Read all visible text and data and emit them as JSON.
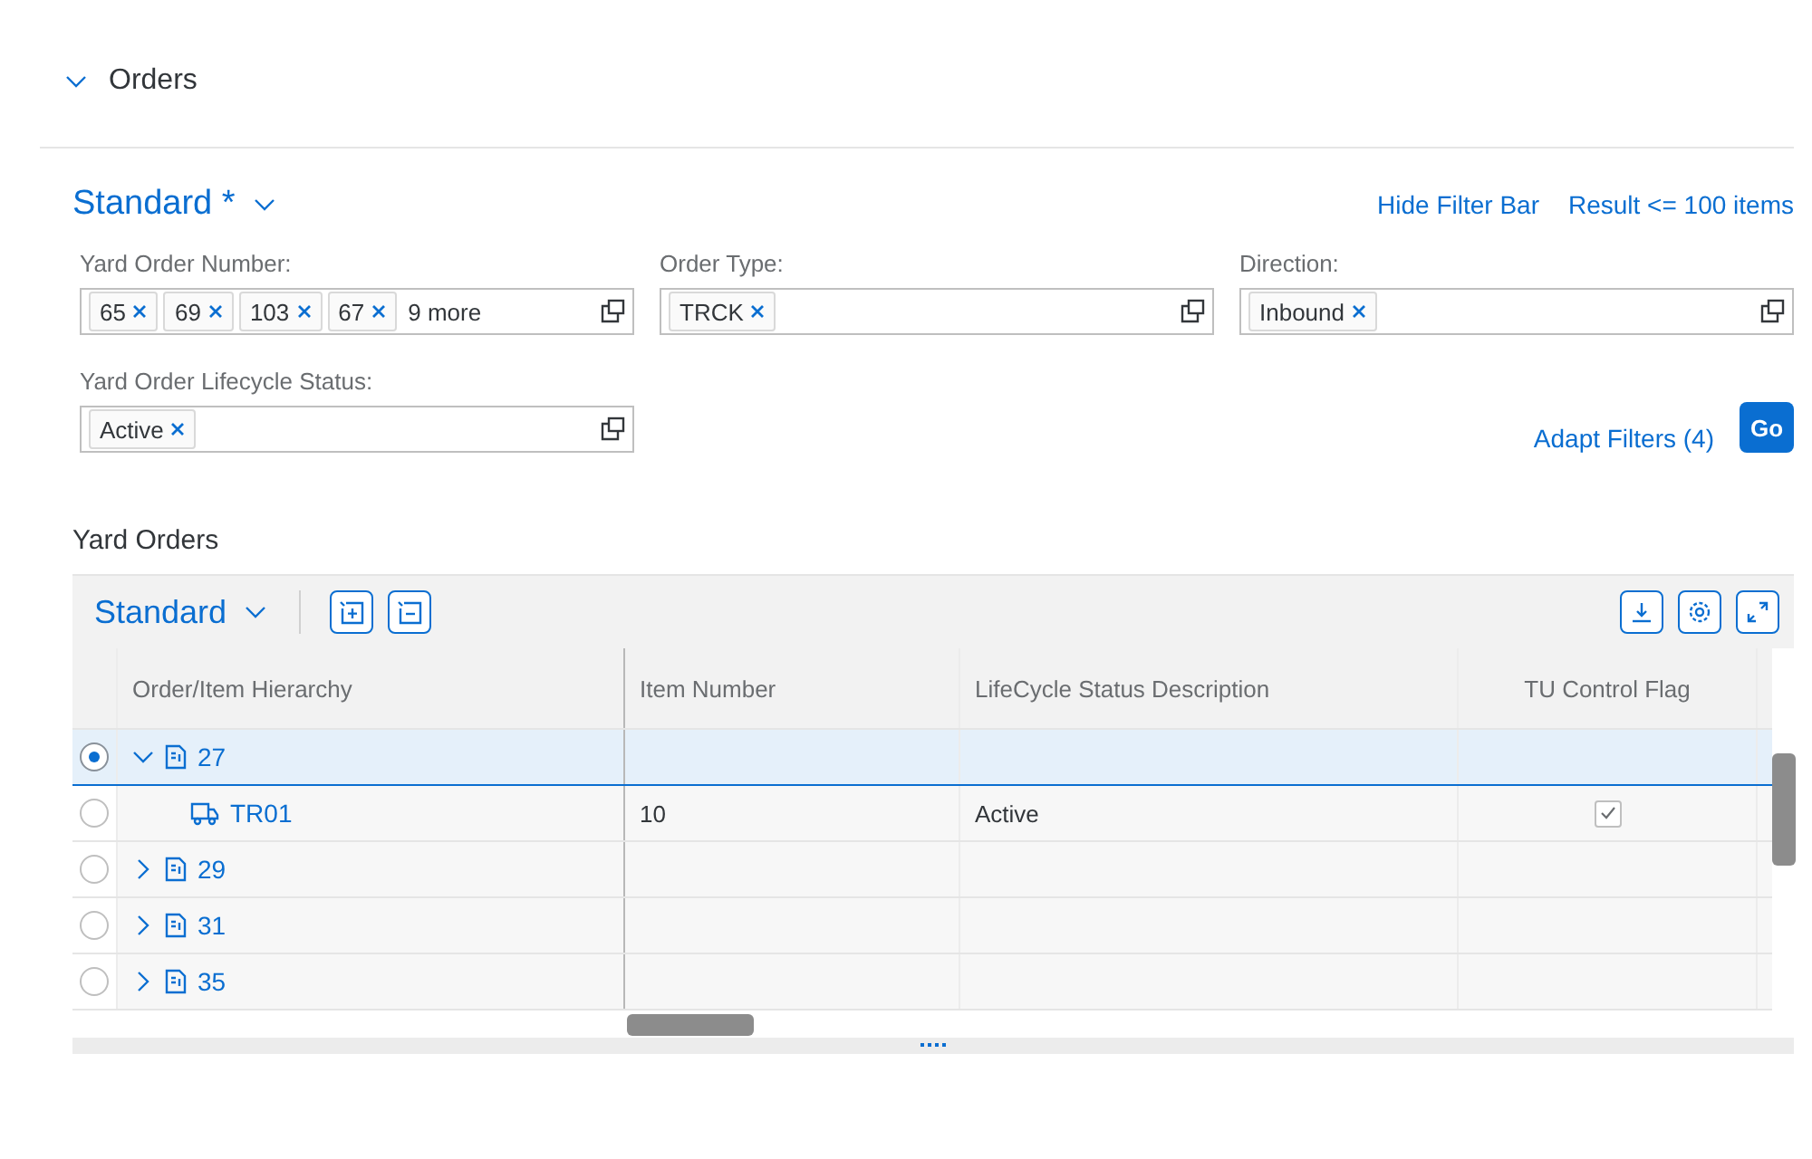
{
  "section": {
    "title": "Orders",
    "expanded": true
  },
  "filter_bar": {
    "variant": "Standard *",
    "hide_link": "Hide Filter Bar",
    "result_info": "Result <= 100 items",
    "adapt_link": "Adapt Filters (4)",
    "go_button": "Go",
    "filters": [
      {
        "label": "Yard Order Number:",
        "tokens": [
          "65",
          "69",
          "103",
          "67"
        ],
        "more": "9 more"
      },
      {
        "label": "Order Type:",
        "tokens": [
          "TRCK"
        ]
      },
      {
        "label": "Direction:",
        "tokens": [
          "Inbound"
        ]
      },
      {
        "label": "Yard Order Lifecycle Status:",
        "tokens": [
          "Active"
        ]
      }
    ]
  },
  "table": {
    "title": "Yard Orders",
    "variant": "Standard",
    "columns": [
      "Order/Item Hierarchy",
      "Item Number",
      "LifeCycle Status Description",
      "TU Control Flag"
    ],
    "rows": [
      {
        "kind": "order",
        "label": "27",
        "selected": true,
        "expanded": true,
        "children": [
          {
            "kind": "item",
            "label": "TR01",
            "selected": false,
            "item_number": "10",
            "status": "Active",
            "tu_control": true
          }
        ]
      },
      {
        "kind": "order",
        "label": "29",
        "selected": false,
        "expanded": false
      },
      {
        "kind": "order",
        "label": "31",
        "selected": false,
        "expanded": false
      },
      {
        "kind": "order",
        "label": "35",
        "selected": false,
        "expanded": false
      }
    ]
  }
}
